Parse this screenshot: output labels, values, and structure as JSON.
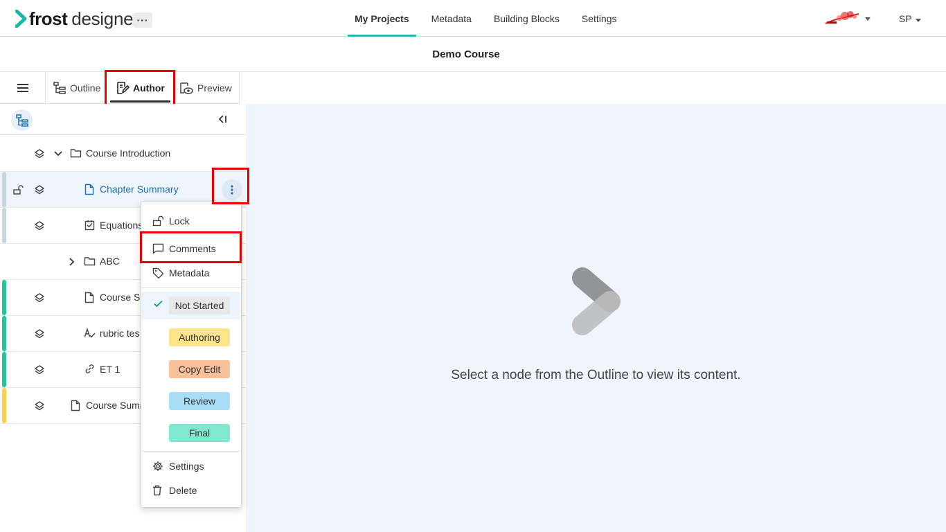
{
  "app": {
    "logo_primary": "frost",
    "logo_secondary": "designer",
    "more_label": "···",
    "brand_color": "#19b9a7"
  },
  "nav": {
    "items": [
      "My Projects",
      "Metadata",
      "Building Blocks",
      "Settings"
    ],
    "active_index": 0,
    "user_initials": "SP"
  },
  "course": {
    "title": "Demo Course"
  },
  "tabs": {
    "items": [
      "Outline",
      "Author",
      "Preview"
    ],
    "active_index": 1
  },
  "outline": {
    "rows": [
      {
        "label": "Course Introduction",
        "type": "folder",
        "expanded": true,
        "status_color": ""
      },
      {
        "label": "Chapter Summary",
        "type": "page",
        "selected": true,
        "locked": false,
        "status_color": "#c9d5dc"
      },
      {
        "label": "Equations",
        "type": "checklist",
        "status_color": "#c9d5dc"
      },
      {
        "label": "ABC",
        "type": "folder",
        "expanded": false,
        "status_color": ""
      },
      {
        "label": "Course Su",
        "type": "page",
        "status_color": "#21c79b"
      },
      {
        "label": "rubric tes",
        "type": "rubric",
        "status_color": "#21c79b"
      },
      {
        "label": "ET 1",
        "type": "link",
        "status_color": "#21c79b"
      },
      {
        "label": "Course Summ",
        "type": "page",
        "status_color": "#f7d24a"
      }
    ]
  },
  "context_menu": {
    "actions": [
      "Lock",
      "Comments",
      "Metadata"
    ],
    "statuses": [
      {
        "label": "Not Started",
        "color": "#e8e8e8",
        "current": true
      },
      {
        "label": "Authoring",
        "color": "#fde38a",
        "current": false
      },
      {
        "label": "Copy Edit",
        "color": "#f8bf9b",
        "current": false
      },
      {
        "label": "Review",
        "color": "#a8def5",
        "current": false
      },
      {
        "label": "Final",
        "color": "#7fe8cf",
        "current": false
      }
    ],
    "footer_actions": [
      "Settings",
      "Delete"
    ]
  },
  "main": {
    "empty_message": "Select a node from the Outline to view its content."
  }
}
